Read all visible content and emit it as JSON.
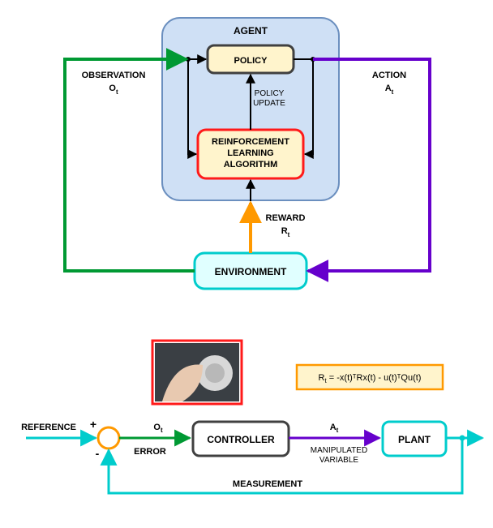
{
  "rl": {
    "agent": "AGENT",
    "policy": "POLICY",
    "algorithm_l1": "REINFORCEMENT",
    "algorithm_l2": "LEARNING",
    "algorithm_l3": "ALGORITHM",
    "policy_update_l1": "POLICY",
    "policy_update_l2": "UPDATE",
    "observation_l1": "OBSERVATION",
    "observation_l2": "O",
    "observation_sub": "t",
    "action_l1": "ACTION",
    "action_l2": "A",
    "action_sub": "t",
    "reward_l1": "REWARD",
    "reward_l2": "R",
    "reward_sub": "t",
    "environment": "ENVIRONMENT"
  },
  "ctrl": {
    "reference": "REFERENCE",
    "plus": "+",
    "minus": "-",
    "error": "ERROR",
    "O": "O",
    "O_sub": "t",
    "controller": "CONTROLLER",
    "A": "A",
    "A_sub": "t",
    "manip_l1": "MANIPULATED",
    "manip_l2": "VARIABLE",
    "plant": "PLANT",
    "measurement": "MEASUREMENT",
    "reward_eq_R": "R",
    "reward_eq_sub": "t",
    "reward_eq_body": " = -x(t)ᵀRx(t) - u(t)ᵀQu(t)"
  },
  "colors": {
    "green": "#009933",
    "purple": "#6600cc",
    "orange": "#ff9900",
    "cyan": "#00cccc",
    "red": "#ff1a1a",
    "agentFill": "#cfe0f5",
    "agentStroke": "#6b8fbf",
    "boxFill": "#fff4cc",
    "envFill": "#e0ffff",
    "dark": "#404040"
  }
}
